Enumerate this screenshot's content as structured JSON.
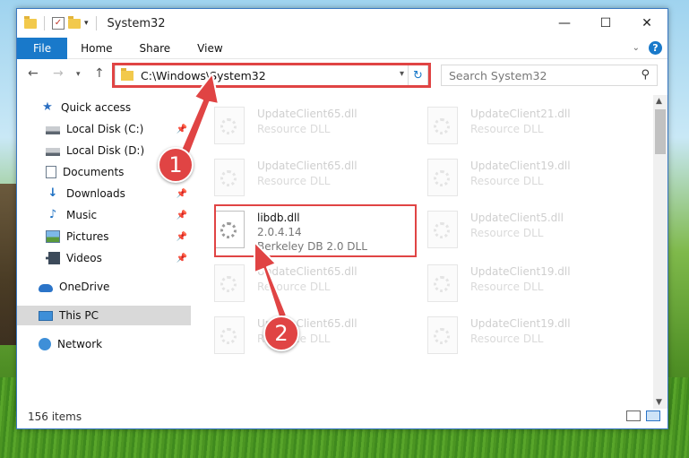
{
  "window": {
    "title": "System32",
    "controls": [
      "—",
      "☐",
      "✕"
    ]
  },
  "ribbon": {
    "tabs": [
      "File",
      "Home",
      "Share",
      "View"
    ]
  },
  "address": {
    "path": "C:\\Windows\\System32",
    "search_placeholder": "Search System32"
  },
  "sidebar": {
    "items": [
      {
        "label": "Quick access"
      },
      {
        "label": "Local Disk (C:)"
      },
      {
        "label": "Local Disk (D:)"
      },
      {
        "label": "Documents"
      },
      {
        "label": "Downloads"
      },
      {
        "label": "Music"
      },
      {
        "label": "Pictures"
      },
      {
        "label": "Videos"
      },
      {
        "label": "OneDrive"
      },
      {
        "label": "This PC"
      },
      {
        "label": "Network"
      }
    ]
  },
  "files": [
    {
      "name": "UpdateClient65.dll",
      "desc": "Resource DLL"
    },
    {
      "name": "UpdateClient21.dll",
      "desc": "Resource DLL"
    },
    {
      "name": "UpdateClient65.dll",
      "desc": "Resource DLL"
    },
    {
      "name": "UpdateClient19.dll",
      "desc": "Resource DLL"
    },
    {
      "name": "libdb.dll",
      "version": "2.0.4.14",
      "desc": "Berkeley DB 2.0 DLL"
    },
    {
      "name": "UpdateClient5.dll",
      "desc": "Resource DLL"
    },
    {
      "name": "UpdateClient65.dll",
      "desc": "Resource DLL"
    },
    {
      "name": "UpdateClient19.dll",
      "desc": "Resource DLL"
    },
    {
      "name": "UpdateClient65.dll",
      "desc": "Resource DLL"
    },
    {
      "name": "UpdateClient19.dll",
      "desc": "Resource DLL"
    }
  ],
  "status": {
    "item_count": "156 items"
  },
  "annotations": {
    "marker1": "1",
    "marker2": "2",
    "color": "#e04444"
  }
}
